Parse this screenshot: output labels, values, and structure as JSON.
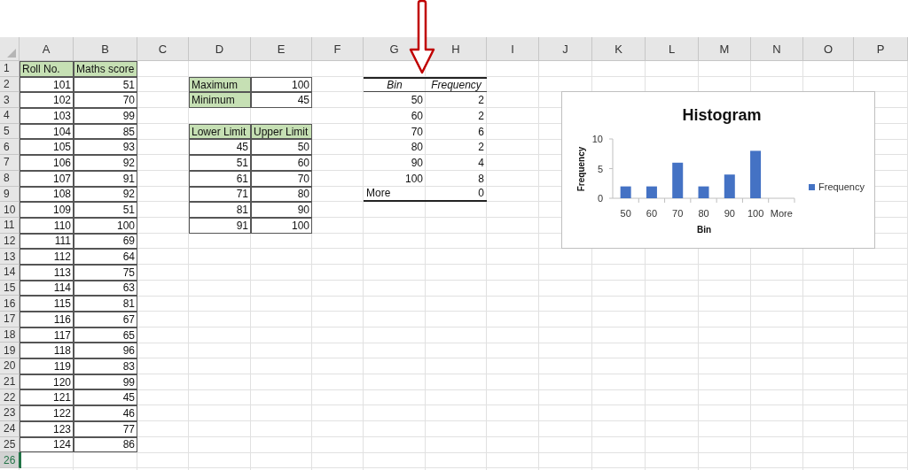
{
  "columns": [
    "A",
    "B",
    "C",
    "D",
    "E",
    "F",
    "G",
    "H",
    "I",
    "J",
    "K",
    "L",
    "M",
    "N",
    "O",
    "P"
  ],
  "rows": [
    {
      "number": "1",
      "selected": false,
      "cells": [
        {
          "kind": "label",
          "text": "Roll No."
        },
        {
          "kind": "label",
          "text": "Maths score"
        }
      ]
    },
    {
      "number": "2",
      "selected": false,
      "cells": [
        {
          "kind": "number",
          "text": "101"
        },
        {
          "kind": "number",
          "text": "51"
        },
        {
          "kind": "empty"
        },
        {
          "kind": "label",
          "text": "Maximum"
        },
        {
          "kind": "number",
          "text": "100"
        },
        {
          "kind": "empty"
        },
        {
          "kind": "bin-header",
          "text": "Bin"
        },
        {
          "kind": "bin-header",
          "text": "Frequency"
        }
      ]
    },
    {
      "number": "3",
      "selected": false,
      "cells": [
        {
          "kind": "number",
          "text": "102"
        },
        {
          "kind": "number",
          "text": "70"
        },
        {
          "kind": "empty"
        },
        {
          "kind": "label",
          "text": "Minimum"
        },
        {
          "kind": "number",
          "text": "45"
        },
        {
          "kind": "empty"
        },
        {
          "kind": "bin-number",
          "text": "50"
        },
        {
          "kind": "bin-number",
          "text": "2"
        }
      ]
    },
    {
      "number": "4",
      "selected": false,
      "cells": [
        {
          "kind": "number",
          "text": "103"
        },
        {
          "kind": "number",
          "text": "99"
        },
        {
          "kind": "empty"
        },
        {
          "kind": "empty"
        },
        {
          "kind": "empty"
        },
        {
          "kind": "empty"
        },
        {
          "kind": "bin-number",
          "text": "60"
        },
        {
          "kind": "bin-number",
          "text": "2"
        }
      ]
    },
    {
      "number": "5",
      "selected": false,
      "cells": [
        {
          "kind": "number",
          "text": "104"
        },
        {
          "kind": "number",
          "text": "85"
        },
        {
          "kind": "empty"
        },
        {
          "kind": "label",
          "text": "Lower Limit"
        },
        {
          "kind": "label",
          "text": "Upper Limit"
        },
        {
          "kind": "empty"
        },
        {
          "kind": "bin-number",
          "text": "70"
        },
        {
          "kind": "bin-number",
          "text": "6"
        }
      ]
    },
    {
      "number": "6",
      "selected": false,
      "cells": [
        {
          "kind": "number",
          "text": "105"
        },
        {
          "kind": "number",
          "text": "93"
        },
        {
          "kind": "empty"
        },
        {
          "kind": "number",
          "text": "45"
        },
        {
          "kind": "number",
          "text": "50"
        },
        {
          "kind": "empty"
        },
        {
          "kind": "bin-number",
          "text": "80"
        },
        {
          "kind": "bin-number",
          "text": "2"
        }
      ]
    },
    {
      "number": "7",
      "selected": false,
      "cells": [
        {
          "kind": "number",
          "text": "106"
        },
        {
          "kind": "number",
          "text": "92"
        },
        {
          "kind": "empty"
        },
        {
          "kind": "number",
          "text": "51"
        },
        {
          "kind": "number",
          "text": "60"
        },
        {
          "kind": "empty"
        },
        {
          "kind": "bin-number",
          "text": "90"
        },
        {
          "kind": "bin-number",
          "text": "4"
        }
      ]
    },
    {
      "number": "8",
      "selected": false,
      "cells": [
        {
          "kind": "number",
          "text": "107"
        },
        {
          "kind": "number",
          "text": "91"
        },
        {
          "kind": "empty"
        },
        {
          "kind": "number",
          "text": "61"
        },
        {
          "kind": "number",
          "text": "70"
        },
        {
          "kind": "empty"
        },
        {
          "kind": "bin-number",
          "text": "100"
        },
        {
          "kind": "bin-number",
          "text": "8"
        }
      ]
    },
    {
      "number": "9",
      "selected": false,
      "cells": [
        {
          "kind": "number",
          "text": "108"
        },
        {
          "kind": "number",
          "text": "92"
        },
        {
          "kind": "empty"
        },
        {
          "kind": "number",
          "text": "71"
        },
        {
          "kind": "number",
          "text": "80"
        },
        {
          "kind": "empty"
        },
        {
          "kind": "bin-text-last",
          "text": "More"
        },
        {
          "kind": "bin-number-last",
          "text": "0"
        }
      ]
    },
    {
      "number": "10",
      "selected": false,
      "cells": [
        {
          "kind": "number",
          "text": "109"
        },
        {
          "kind": "number",
          "text": "51"
        },
        {
          "kind": "empty"
        },
        {
          "kind": "number",
          "text": "81"
        },
        {
          "kind": "number",
          "text": "90"
        }
      ]
    },
    {
      "number": "11",
      "selected": false,
      "cells": [
        {
          "kind": "number",
          "text": "110"
        },
        {
          "kind": "number",
          "text": "100"
        },
        {
          "kind": "empty"
        },
        {
          "kind": "number",
          "text": "91"
        },
        {
          "kind": "number",
          "text": "100"
        }
      ]
    },
    {
      "number": "12",
      "selected": false,
      "cells": [
        {
          "kind": "number",
          "text": "111"
        },
        {
          "kind": "number",
          "text": "69"
        }
      ]
    },
    {
      "number": "13",
      "selected": false,
      "cells": [
        {
          "kind": "number",
          "text": "112"
        },
        {
          "kind": "number",
          "text": "64"
        }
      ]
    },
    {
      "number": "14",
      "selected": false,
      "cells": [
        {
          "kind": "number",
          "text": "113"
        },
        {
          "kind": "number",
          "text": "75"
        }
      ]
    },
    {
      "number": "15",
      "selected": false,
      "cells": [
        {
          "kind": "number",
          "text": "114"
        },
        {
          "kind": "number",
          "text": "63"
        }
      ]
    },
    {
      "number": "16",
      "selected": false,
      "cells": [
        {
          "kind": "number",
          "text": "115"
        },
        {
          "kind": "number",
          "text": "81"
        }
      ]
    },
    {
      "number": "17",
      "selected": false,
      "cells": [
        {
          "kind": "number",
          "text": "116"
        },
        {
          "kind": "number",
          "text": "67"
        }
      ]
    },
    {
      "number": "18",
      "selected": false,
      "cells": [
        {
          "kind": "number",
          "text": "117"
        },
        {
          "kind": "number",
          "text": "65"
        }
      ]
    },
    {
      "number": "19",
      "selected": false,
      "cells": [
        {
          "kind": "number",
          "text": "118"
        },
        {
          "kind": "number",
          "text": "96"
        }
      ]
    },
    {
      "number": "20",
      "selected": false,
      "cells": [
        {
          "kind": "number",
          "text": "119"
        },
        {
          "kind": "number",
          "text": "83"
        }
      ]
    },
    {
      "number": "21",
      "selected": false,
      "cells": [
        {
          "kind": "number",
          "text": "120"
        },
        {
          "kind": "number",
          "text": "99"
        }
      ]
    },
    {
      "number": "22",
      "selected": false,
      "cells": [
        {
          "kind": "number",
          "text": "121"
        },
        {
          "kind": "number",
          "text": "45"
        }
      ]
    },
    {
      "number": "23",
      "selected": false,
      "cells": [
        {
          "kind": "number",
          "text": "122"
        },
        {
          "kind": "number",
          "text": "46"
        }
      ]
    },
    {
      "number": "24",
      "selected": false,
      "cells": [
        {
          "kind": "number",
          "text": "123"
        },
        {
          "kind": "number",
          "text": "77"
        }
      ]
    },
    {
      "number": "25",
      "selected": false,
      "cells": [
        {
          "kind": "number",
          "text": "124"
        },
        {
          "kind": "number",
          "text": "86"
        }
      ]
    },
    {
      "number": "26",
      "selected": true,
      "cells": []
    }
  ],
  "chart": {
    "chart_data": {
      "type": "bar",
      "title": "Histogram",
      "xlabel": "Bin",
      "ylabel": "Frequency",
      "categories": [
        "50",
        "60",
        "70",
        "80",
        "90",
        "100",
        "More"
      ],
      "series": [
        {
          "name": "Frequency",
          "color": "#4472c4",
          "values": [
            2,
            2,
            6,
            2,
            4,
            8,
            0
          ]
        }
      ],
      "ylim": [
        0,
        10
      ],
      "yticks": [
        0,
        5,
        10
      ]
    }
  }
}
